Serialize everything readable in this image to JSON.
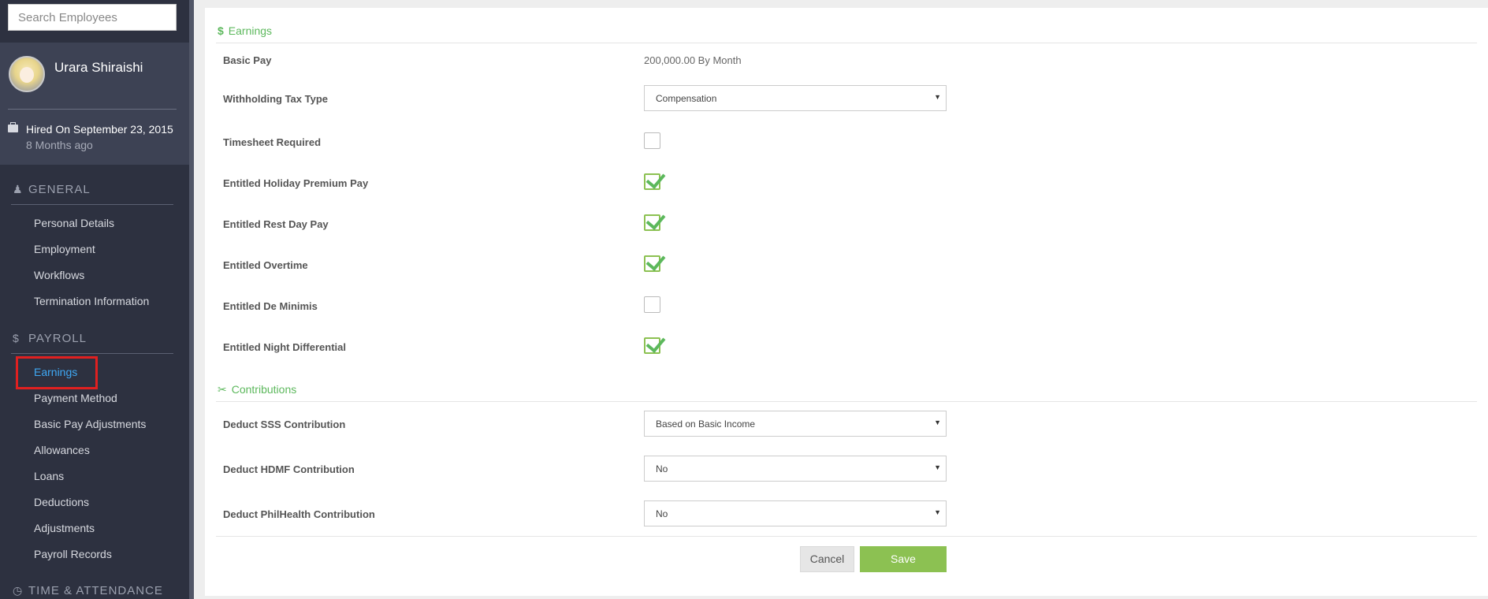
{
  "search": {
    "placeholder": "Search Employees"
  },
  "profile": {
    "name": "Urara Shiraishi",
    "hired": "Hired On September 23, 2015",
    "hired_ago": "8 Months ago"
  },
  "sidebar": {
    "general": {
      "title": "GENERAL",
      "icon": "user-icon",
      "items": [
        "Personal Details",
        "Employment",
        "Workflows",
        "Termination Information"
      ]
    },
    "payroll": {
      "title": "PAYROLL",
      "icon": "dollar-icon",
      "items": [
        "Earnings",
        "Payment Method",
        "Basic Pay Adjustments",
        "Allowances",
        "Loans",
        "Deductions",
        "Adjustments",
        "Payroll Records"
      ],
      "active": "Earnings"
    },
    "time": {
      "title": "TIME & ATTENDANCE",
      "icon": "clock-icon"
    }
  },
  "earnings": {
    "title": "Earnings",
    "basic_pay_label": "Basic Pay",
    "basic_pay_value": "200,000.00 By Month",
    "withholding_label": "Withholding Tax Type",
    "withholding_value": "Compensation",
    "timesheet_label": "Timesheet Required",
    "timesheet_checked": false,
    "holiday_label": "Entitled Holiday Premium Pay",
    "holiday_checked": true,
    "restday_label": "Entitled Rest Day Pay",
    "restday_checked": true,
    "overtime_label": "Entitled Overtime",
    "overtime_checked": true,
    "deminimis_label": "Entitled De Minimis",
    "deminimis_checked": false,
    "night_label": "Entitled Night Differential",
    "night_checked": true
  },
  "contributions": {
    "title": "Contributions",
    "sss_label": "Deduct SSS Contribution",
    "sss_value": "Based on Basic Income",
    "hdmf_label": "Deduct HDMF Contribution",
    "hdmf_value": "No",
    "philhealth_label": "Deduct PhilHealth Contribution",
    "philhealth_value": "No"
  },
  "actions": {
    "cancel": "Cancel",
    "save": "Save"
  },
  "colors": {
    "sidebar": "#2d3140",
    "accent_green": "#8cc152",
    "active_link": "#3fa9f5",
    "highlight_red": "#e02020"
  }
}
